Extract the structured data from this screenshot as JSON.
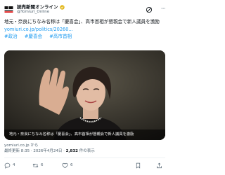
{
  "account": {
    "display_name": "読売新聞オンライン",
    "handle": "@Yomiuri_Online",
    "logo_icon": "yomiuri-logo-icon",
    "verified_icon": "gold-verified-icon"
  },
  "header": {
    "more_label": "···",
    "grok_icon": "grok-icon"
  },
  "tweet": {
    "text": "地元・奈良にちなみ名称は「慶喜会」、高市首相が懇親会で新人議員を激励",
    "link": "yomiuri.co.jp/politics/20260...",
    "hashtags": [
      "#政治",
      "#慶喜会",
      "#高市首相"
    ]
  },
  "media": {
    "caption": "地元・奈良にちなみ名称は「慶喜会」、高市首相が懇親会で新人議員を激励"
  },
  "link_source": "yomiuri.co.jp から",
  "meta": {
    "time": "最終更新 8:35 · 2026年4月24日 · ",
    "views_count": "2,832",
    "views_label": " 件の表示"
  },
  "actions": {
    "reply_count": "4",
    "repost_count": "6",
    "like_count": "6",
    "bookmark_count": "",
    "colors": {
      "muted": "#536471",
      "link": "#1d9bf0"
    }
  }
}
